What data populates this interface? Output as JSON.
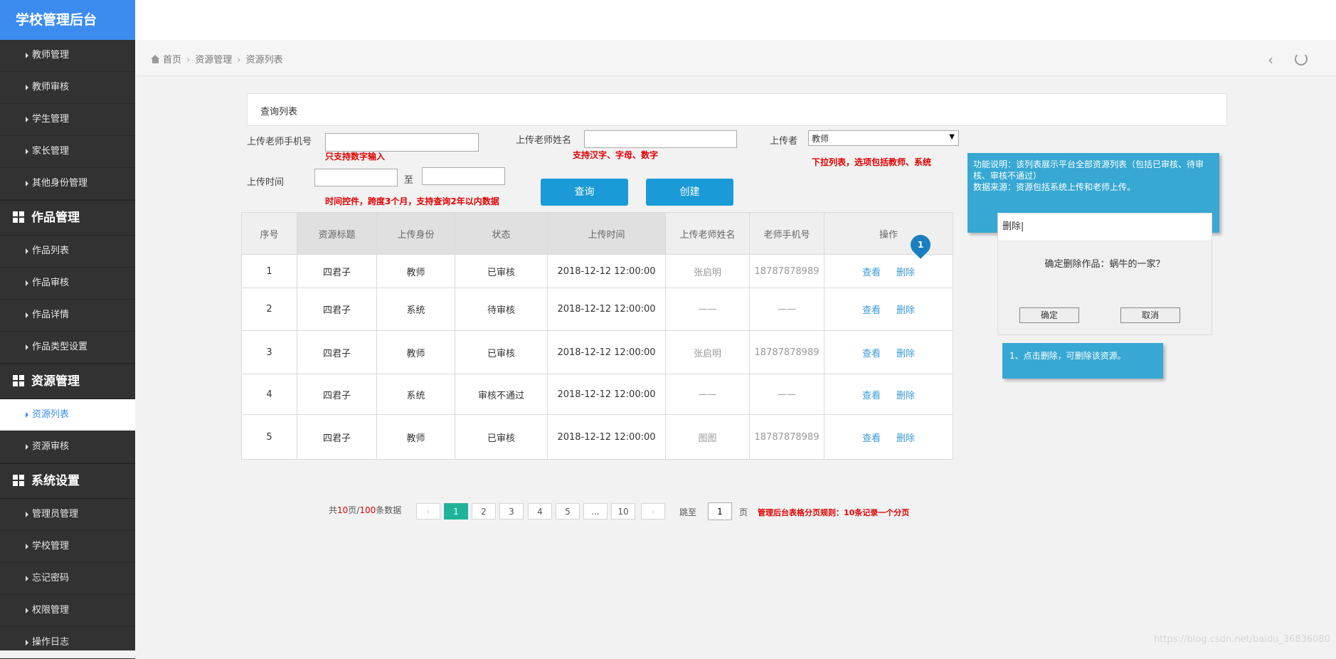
{
  "app": {
    "title": "学校管理后台"
  },
  "sidebar": {
    "items_top": [
      "教师管理",
      "教师审核",
      "学生管理",
      "家长管理",
      "其他身份管理"
    ],
    "group1": {
      "label": "作品管理",
      "items": [
        "作品列表",
        "作品审核",
        "作品详情",
        "作品类型设置"
      ]
    },
    "group2": {
      "label": "资源管理",
      "items": [
        "资源列表",
        "资源审核"
      ],
      "active": "资源列表"
    },
    "group3": {
      "label": "系统设置",
      "items": [
        "管理员管理",
        "学校管理",
        "忘记密码",
        "权限管理",
        "操作日志"
      ]
    }
  },
  "breadcrumb": {
    "home": "首页",
    "level1": "资源管理",
    "level2": "资源列表"
  },
  "panel": {
    "title": "查询列表"
  },
  "filters": {
    "phone_label": "上传老师手机号",
    "phone_value": "",
    "phone_note": "只支持数字输入",
    "name_label": "上传老师姓名",
    "name_value": "",
    "name_note": "支持汉字、字母、数字",
    "uploader_label": "上传者",
    "uploader_value": "教师",
    "uploader_note": "下拉列表，选项包括教师、系统",
    "time_label": "上传时间",
    "time_to": "至",
    "time_note": "时间控件，跨度3个月，支持查询2年以内数据"
  },
  "buttons": {
    "query": "查询",
    "create": "创建"
  },
  "table": {
    "headers": [
      "序号",
      "资源标题",
      "上传身份",
      "状态",
      "上传时间",
      "上传老师姓名",
      "老师手机号",
      "操作"
    ],
    "view_label": "查看",
    "delete_label": "删除",
    "rows": [
      [
        "1",
        "四君子",
        "教师",
        "已审核",
        "2018-12-12 12:00:00",
        "张启明",
        "18787878989"
      ],
      [
        "2",
        "四君子",
        "系统",
        "待审核",
        "2018-12-12 12:00:00",
        "——",
        "——"
      ],
      [
        "3",
        "四君子",
        "教师",
        "已审核",
        "2018-12-12 12:00:00",
        "张启明",
        "18787878989"
      ],
      [
        "4",
        "四君子",
        "系统",
        "审核不通过",
        "2018-12-12 12:00:00",
        "——",
        "——"
      ],
      [
        "5",
        "四君子",
        "教师",
        "已审核",
        "2018-12-12 12:00:00",
        "图图",
        "18787878989"
      ]
    ]
  },
  "marker": {
    "number": "1"
  },
  "tip_main": {
    "line1": "功能说明：该列表展示平台全部资源列表（包括已审核、待审核、审核不通过）",
    "line2": "数据来源：资源包括系统上传和老师上传。"
  },
  "dialog": {
    "title": "删除|",
    "message": "确定删除作品：蜗牛的一家？",
    "ok": "确定",
    "cancel": "取消"
  },
  "tip_delete": {
    "text": "1、点击删除，可删除该资源。"
  },
  "pagination": {
    "total_prefix": "共",
    "total_pages": "10",
    "total_mid": "页/",
    "total_records": "100",
    "total_suffix": "条数据",
    "prev": "",
    "pages": [
      "1",
      "2",
      "3",
      "4",
      "5",
      "...",
      "10"
    ],
    "next": "",
    "jump_label": "跳至",
    "jump_value": "1",
    "page_unit": "页",
    "rule_note": "管理后台表格分页规则：10条记录一个分页"
  },
  "watermark": "https://blog.csdn.net/baidu_36836080",
  "colors": {
    "sidebar_bg": "#323232",
    "logo_bg": "#3c8cf0",
    "button": "#1a9ad6",
    "tip": "#36a8d3",
    "note": "#e00000",
    "page_active": "#1fb39a"
  }
}
